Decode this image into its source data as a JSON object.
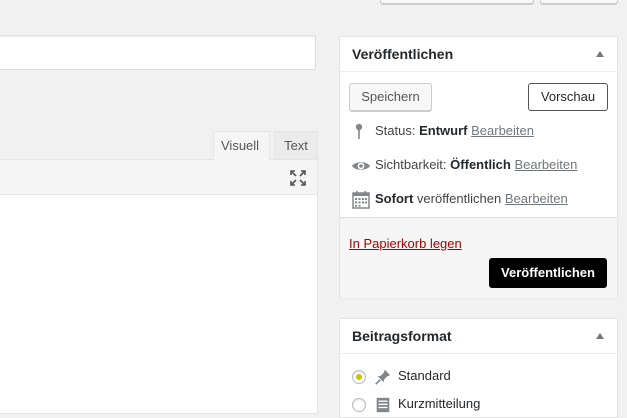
{
  "editor": {
    "tabs": [
      {
        "label": "Visuell",
        "active": true
      },
      {
        "label": "Text",
        "active": false
      }
    ],
    "fullscreen_icon": "fullscreen-expand-icon"
  },
  "publish": {
    "title": "Veröffentlichen",
    "save_label": "Speichern",
    "preview_label": "Vorschau",
    "status": {
      "label": "Status:",
      "value": "Entwurf",
      "edit": "Bearbeiten",
      "icon": "pin-icon"
    },
    "visibility": {
      "label": "Sichtbarkeit:",
      "value": "Öffentlich",
      "edit": "Bearbeiten",
      "icon": "eye-icon"
    },
    "schedule": {
      "value": "Sofort",
      "label": "veröffentlichen",
      "edit": "Bearbeiten",
      "icon": "calendar-icon"
    },
    "trash_label": "In Papierkorb legen",
    "publish_label": "Veröffentlichen",
    "colors": {
      "trash": "#aa0000",
      "publish_bg": "#000000"
    }
  },
  "format": {
    "title": "Beitragsformat",
    "options": [
      {
        "label": "Standard",
        "checked": true,
        "icon": "pin-icon"
      },
      {
        "label": "Kurzmitteilung",
        "checked": false,
        "icon": "aside-icon"
      }
    ]
  }
}
